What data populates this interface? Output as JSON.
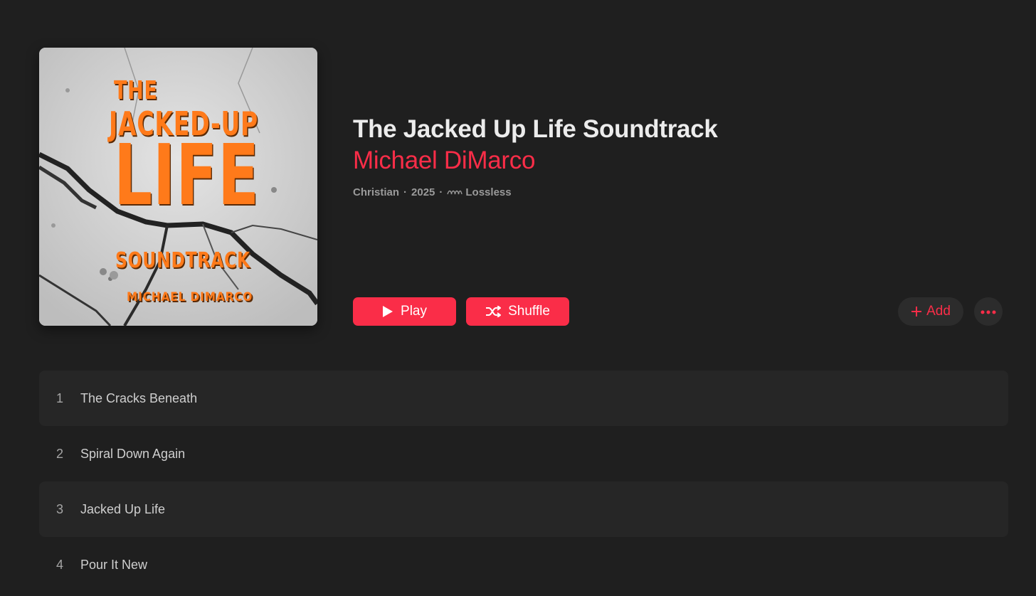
{
  "album": {
    "title": "The Jacked Up Life Soundtrack",
    "artist": "Michael DiMarco",
    "genre": "Christian",
    "year": "2025",
    "quality": "Lossless",
    "separator": "·"
  },
  "artwork": {
    "line1": "THE",
    "line2": "JACKED-UP",
    "line3": "LIFE",
    "line4": "SOUNDTRACK",
    "line5": "MICHAEL DIMARCO"
  },
  "actions": {
    "play_label": "Play",
    "shuffle_label": "Shuffle",
    "add_label": "Add"
  },
  "tracks": [
    {
      "number": "1",
      "title": "The Cracks Beneath"
    },
    {
      "number": "2",
      "title": "Spiral Down Again"
    },
    {
      "number": "3",
      "title": "Jacked Up Life"
    },
    {
      "number": "4",
      "title": "Pour It New"
    }
  ],
  "colors": {
    "accent": "#fa2d48",
    "background": "#1f1f1f",
    "artwork_orange": "#ff7a1a"
  }
}
